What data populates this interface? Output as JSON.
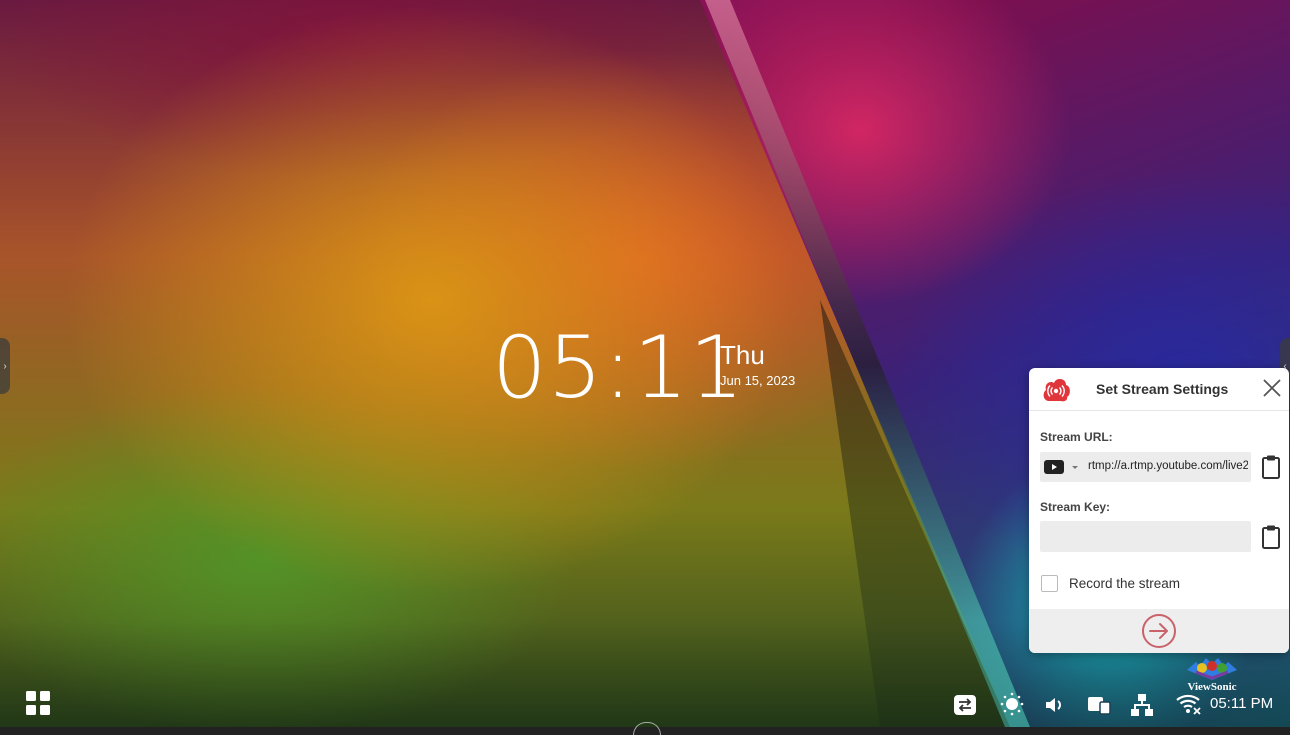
{
  "clock": {
    "time": "05:11",
    "day": "Thu",
    "date": "Jun 15, 2023"
  },
  "dialog": {
    "title": "Set Stream Settings",
    "url_label": "Stream URL:",
    "url_value": "rtmp://a.rtmp.youtube.com/live2",
    "platform": "youtube-icon",
    "key_label": "Stream Key:",
    "key_value": "",
    "record_label": "Record the stream",
    "record_checked": false,
    "accent_color": "#e0353b",
    "start_button_color": "#c9636b"
  },
  "taskbar": {
    "clock": "05:11 PM",
    "icons": [
      "apps-grid-icon",
      "input-switch-icon",
      "brightness-icon",
      "volume-icon",
      "devices-icon",
      "network-icon",
      "wifi-icon"
    ]
  },
  "brand": {
    "name": "ViewSonic"
  }
}
